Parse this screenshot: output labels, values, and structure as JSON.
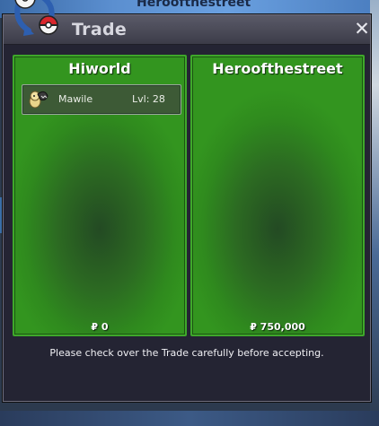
{
  "background": {
    "player_name": "Heroofthestreet"
  },
  "window": {
    "title": "Trade",
    "close_label": "✕",
    "logo_icon": "trade-pokeballs-icon"
  },
  "left_panel": {
    "trainer": "Hiworld",
    "pokemon": [
      {
        "name": "Mawile",
        "level": "Lvl: 28",
        "icon": "mawile-icon"
      }
    ],
    "money": "₽ 0"
  },
  "right_panel": {
    "trainer": "Heroofthestreet",
    "pokemon": [],
    "money": "₽ 750,000"
  },
  "notice": "Please check over the Trade carefully before accepting.",
  "colors": {
    "panel_green": "#2f8a1e",
    "panel_border": "#3ea82a",
    "window_bg": "#242433",
    "titlebar": "#4a4a57"
  }
}
